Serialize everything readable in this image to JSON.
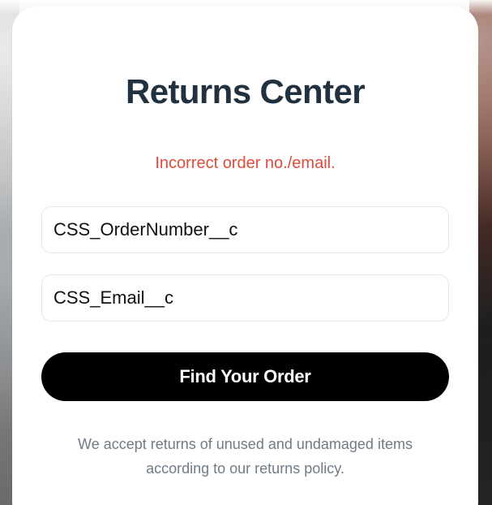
{
  "returns_center": {
    "title": "Returns Center",
    "error_message": "Incorrect order no./email.",
    "order_number_value": "CSS_OrderNumber__c",
    "email_value": "CSS_Email__c",
    "find_order_button": "Find Your Order",
    "policy_line_1": "We accept returns of unused and undamaged items",
    "policy_line_2": "according to our returns policy."
  },
  "colors": {
    "title": "#22313f",
    "error": "#e04b3c",
    "button_bg": "#000000",
    "button_text": "#ffffff",
    "policy_text": "#6f7b86",
    "field_border": "#e6e6e6",
    "card_bg": "#ffffff"
  }
}
